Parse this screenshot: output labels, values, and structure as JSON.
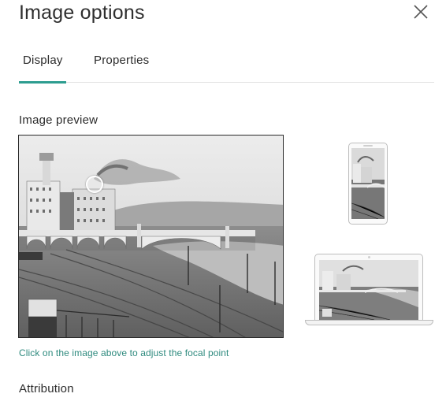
{
  "dialog": {
    "title": "Image options",
    "close_icon": "close-icon"
  },
  "tabs": [
    {
      "label": "Display",
      "selected": true
    },
    {
      "label": "Properties",
      "selected": false
    }
  ],
  "colors": {
    "accent": "#2e9d90",
    "hint_text": "#2e8a7e"
  },
  "preview": {
    "label": "Image preview",
    "hint": "Click on the image above to adjust the focal point",
    "devices": [
      "phone",
      "laptop"
    ]
  },
  "attribution": {
    "label": "Attribution"
  }
}
